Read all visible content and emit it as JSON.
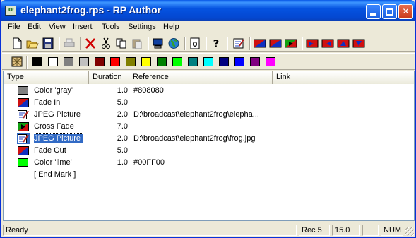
{
  "window": {
    "title": "elephant2frog.rps - RP Author",
    "icon_label": "RP"
  },
  "menu": [
    {
      "label": "File",
      "acc": "F",
      "rest": "ile"
    },
    {
      "label": "Edit",
      "acc": "E",
      "rest": "dit"
    },
    {
      "label": "View",
      "acc": "V",
      "rest": "iew"
    },
    {
      "label": "Insert",
      "acc": "I",
      "rest": "nsert"
    },
    {
      "label": "Tools",
      "acc": "T",
      "rest": "ools"
    },
    {
      "label": "Settings",
      "acc": "S",
      "rest": "ettings"
    },
    {
      "label": "Help",
      "acc": "H",
      "rest": "elp"
    }
  ],
  "toolbar_icons": [
    "new-file-icon",
    "open-folder-icon",
    "save-icon",
    "print-icon",
    "delete-icon",
    "cut-icon",
    "copy-icon",
    "paste-icon",
    "preview-computer-icon",
    "web-globe-icon",
    "info-icon",
    "help-icon",
    "edit-properties-icon",
    "fade-in-icon",
    "fade-out-icon",
    "cross-fade-icon",
    "wipe-right-icon",
    "wipe-left-icon",
    "wipe-up-icon",
    "wipe-down-icon"
  ],
  "palette": {
    "colors": [
      "#000000",
      "#ffffff",
      "#808080",
      "#c0c0c0",
      "#800000",
      "#ff0000",
      "#808000",
      "#ffff00",
      "#008000",
      "#00ff00",
      "#008080",
      "#00ffff",
      "#000080",
      "#0000ff",
      "#800080",
      "#ff00ff"
    ]
  },
  "list": {
    "columns": [
      "Type",
      "Duration",
      "Reference",
      "Link"
    ],
    "rows": [
      {
        "icon": "color-swatch-icon",
        "icon_color": "#808080",
        "type": "Color 'gray'",
        "duration": "1.0",
        "reference": "#808080"
      },
      {
        "icon": "fade-in-icon",
        "type": "Fade In",
        "duration": "5.0",
        "reference": ""
      },
      {
        "icon": "jpeg-picture-icon",
        "type": "JPEG Picture",
        "duration": "2.0",
        "reference": "D:\\broadcast\\elephant2frog\\elepha..."
      },
      {
        "icon": "cross-fade-icon",
        "type": "Cross Fade",
        "duration": "7.0",
        "reference": ""
      },
      {
        "icon": "jpeg-picture-icon",
        "type": "JPEG Picture",
        "duration": "2.0",
        "reference": "D:\\broadcast\\elephant2frog\\frog.jpg",
        "selected": true
      },
      {
        "icon": "fade-out-icon",
        "type": "Fade Out",
        "duration": "5.0",
        "reference": ""
      },
      {
        "icon": "color-swatch-icon",
        "icon_color": "#00ff00",
        "type": "Color 'lime'",
        "duration": "1.0",
        "reference": "#00FF00"
      },
      {
        "icon": "",
        "type": "[ End Mark ]",
        "duration": "",
        "reference": ""
      }
    ]
  },
  "status": {
    "message": "Ready",
    "record": "Rec 5",
    "time": "15.0",
    "empty": "",
    "num": "NUM"
  }
}
